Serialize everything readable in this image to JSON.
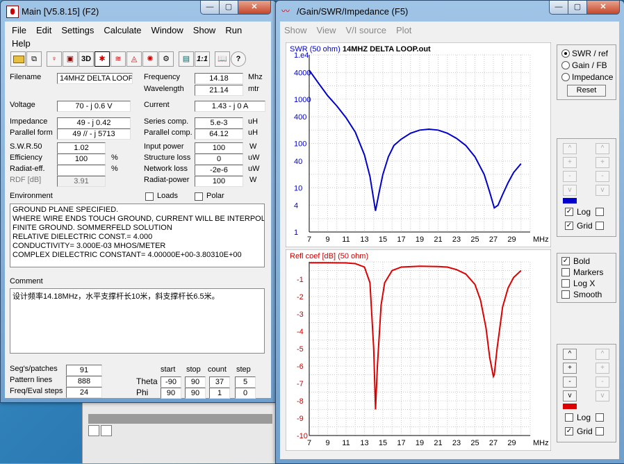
{
  "main_window": {
    "title": "Main [V5.8.15]  (F2)",
    "menu": [
      "File",
      "Edit",
      "Settings",
      "Calculate",
      "Window",
      "Show",
      "Run",
      "Help"
    ],
    "toolbar_icons": [
      "open-folder-icon",
      "copy-icon",
      "geometry-icon",
      "view-3d-icon",
      "pattern-icon",
      "wave-icon",
      "swr-icon",
      "radiation-icon",
      "setup-icon",
      "calculator-icon",
      "ratio-icon",
      "book-icon",
      "help-icon"
    ],
    "toolbar_text": {
      "view3d": "3D",
      "ratio": "1:1"
    },
    "labels": {
      "filename": "Filename",
      "frequency": "Frequency",
      "frequency_unit": "Mhz",
      "wavelength": "Wavelength",
      "wavelength_unit": "mtr",
      "voltage": "Voltage",
      "current": "Current",
      "impedance": "Impedance",
      "series_comp": "Series comp.",
      "series_unit": "uH",
      "parallel_form": "Parallel form",
      "parallel_comp": "Parallel comp.",
      "parallel_unit": "uH",
      "swr50": "S.W.R.50",
      "input_power": "Input power",
      "input_unit": "W",
      "efficiency": "Efficiency",
      "efficiency_unit": "%",
      "structure_loss": "Structure loss",
      "structure_unit": "uW",
      "radiat_eff": "Radiat-eff.",
      "radiat_eff_unit": "%",
      "network_loss": "Network loss",
      "network_unit": "uW",
      "rdf": "RDF [dB]",
      "radiat_power": "Radiat-power",
      "radiat_power_unit": "W",
      "environment": "Environment",
      "loads": "Loads",
      "polar": "Polar",
      "comment": "Comment",
      "segs": "Seg's/patches",
      "pattern_lines": "Pattern lines",
      "freq_eval": "Freq/Eval steps",
      "start": "start",
      "stop": "stop",
      "count": "count",
      "step": "step",
      "theta": "Theta",
      "phi": "Phi"
    },
    "values": {
      "filename": "14MHZ DELTA LOOP",
      "frequency": "14.18",
      "wavelength": "21.14",
      "voltage": "70 - j 0.6 V",
      "current": "1.43 - j 0 A",
      "impedance": "49 - j 0.42",
      "series_comp": "5.e-3",
      "parallel_form": "49 // - j 5713",
      "parallel_comp": "64.12",
      "swr50": "1.02",
      "input_power": "100",
      "efficiency": "100",
      "structure_loss": "0",
      "radiat_eff": "",
      "network_loss": "-2e-6",
      "rdf": "3.91",
      "radiat_power": "100",
      "segs": "91",
      "pattern_lines": "888",
      "freq_eval": "24",
      "theta_start": "-90",
      "theta_stop": "90",
      "theta_count": "37",
      "theta_step": "5",
      "phi_start": "90",
      "phi_stop": "90",
      "phi_count": "1",
      "phi_step": "0"
    },
    "environment_lines": [
      "GROUND PLANE SPECIFIED.",
      "WHERE WIRE ENDS TOUCH GROUND, CURRENT WILL BE INTERPOLATED",
      "FINITE GROUND.  SOMMERFELD SOLUTION",
      "RELATIVE DIELECTRIC CONST.=  4.000",
      "CONDUCTIVITY= 3.000E-03 MHOS/METER",
      "COMPLEX DIELECTRIC CONSTANT= 4.00000E+00-3.80310E+00"
    ],
    "comment": "设计频率14.18MHz，水平支撑杆长10米，斜支撑杆长6.5米。"
  },
  "swr_window": {
    "title": "/Gain/SWR/Impedance (F5)",
    "menu": [
      "Show",
      "View",
      "V/I source",
      "Plot"
    ],
    "radio_options": [
      "SWR / ref",
      "Gain / FB",
      "Impedance"
    ],
    "reset_label": "Reset",
    "log_label": "Log",
    "grid_label": "Grid",
    "options": [
      "Bold",
      "Markers",
      "Log X",
      "Smooth"
    ],
    "step_buttons": [
      "^",
      "+",
      "-",
      "v"
    ],
    "top_color": "#0000cc",
    "bottom_color": "#dd0000"
  },
  "chart_data": [
    {
      "type": "line",
      "title": "SWR (50 ohm)  14MHZ DELTA LOOP.out",
      "title_label": "SWR (50 ohm)",
      "title_file": "14MHZ DELTA LOOP.out",
      "xlabel": "MHz",
      "x_ticks": [
        7,
        9,
        11,
        13,
        15,
        17,
        19,
        21,
        23,
        25,
        27,
        29
      ],
      "y_ticks": [
        "1.e4",
        "4000",
        "1000",
        "400",
        "100",
        "40",
        "10",
        "4",
        "1"
      ],
      "y_scale": "log",
      "xlim": [
        7,
        31
      ],
      "ylim": [
        1,
        10000
      ],
      "grid": true,
      "series": [
        {
          "color": "#0000cc",
          "x": [
            7,
            8,
            9,
            10,
            11,
            12,
            13,
            13.6,
            14.2,
            14.6,
            15,
            15.6,
            16.2,
            17,
            18,
            19,
            20,
            21,
            22,
            23,
            24,
            25,
            26,
            26.6,
            27.1,
            27.5,
            28,
            28.6,
            29.2,
            30
          ],
          "values": [
            4500,
            2300,
            1200,
            700,
            380,
            180,
            55,
            18,
            3,
            8,
            20,
            50,
            90,
            125,
            170,
            200,
            210,
            200,
            170,
            130,
            90,
            50,
            20,
            8,
            3.5,
            4,
            7,
            13,
            22,
            35
          ]
        }
      ]
    },
    {
      "type": "line",
      "title": "Refl coef [dB] (50 ohm)",
      "xlabel": "MHz",
      "x_ticks": [
        7,
        9,
        11,
        13,
        15,
        17,
        19,
        21,
        23,
        25,
        27,
        29
      ],
      "y_ticks": [
        -1,
        -2,
        -3,
        -4,
        -5,
        -6,
        -7,
        -8,
        -9,
        -10
      ],
      "xlim": [
        7,
        31
      ],
      "ylim": [
        -10,
        0
      ],
      "grid": true,
      "series": [
        {
          "color": "#dd0000",
          "x": [
            7,
            9,
            11,
            12,
            13,
            13.6,
            14,
            14.2,
            14.4,
            14.8,
            15.2,
            16,
            17,
            19,
            21,
            22,
            23,
            24,
            25,
            25.6,
            26.2,
            26.6,
            27,
            27.1,
            27.4,
            28,
            28.6,
            29.2,
            30
          ],
          "values": [
            -0.05,
            -0.05,
            -0.06,
            -0.1,
            -0.3,
            -1.2,
            -5,
            -8.5,
            -6,
            -2.5,
            -1.2,
            -0.5,
            -0.3,
            -0.25,
            -0.27,
            -0.3,
            -0.45,
            -0.7,
            -1.3,
            -2.2,
            -3.8,
            -5.5,
            -6.6,
            -6.5,
            -5,
            -2.6,
            -1.5,
            -0.9,
            -0.5
          ]
        }
      ]
    }
  ]
}
